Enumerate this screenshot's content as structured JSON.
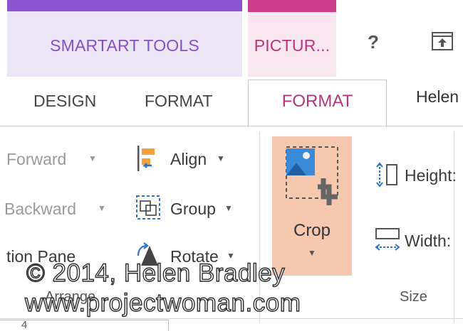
{
  "contextual_tabs": {
    "smartart_tools": "SMARTART TOOLS",
    "picture_tools": "PICTUR..."
  },
  "title_bar": {
    "help_label": "?"
  },
  "tabs": {
    "design": "DESIGN",
    "format_smartart": "FORMAT",
    "format_picture": "FORMAT",
    "user_name": "Helen"
  },
  "arrange_group": {
    "forward_label": "Forward",
    "backward_label": "Backward",
    "selection_pane_label": "tion Pane",
    "align_label": "Align",
    "group_label": "Group",
    "rotate_label": "Rotate",
    "group_name": "Arrange"
  },
  "crop_group": {
    "crop_label": "Crop"
  },
  "size_group": {
    "height_label": "Height:",
    "width_label": "Width:",
    "group_name": "Size"
  },
  "status_bar": {
    "ruler_number": "4"
  },
  "watermark": {
    "line1": "© 2014, Helen Bradley",
    "line2": "www.projectwoman.com"
  },
  "colors": {
    "smartart_accent": "#8b55d2",
    "picture_accent": "#cc3f8a",
    "crop_highlight": "#f6c8b0"
  }
}
